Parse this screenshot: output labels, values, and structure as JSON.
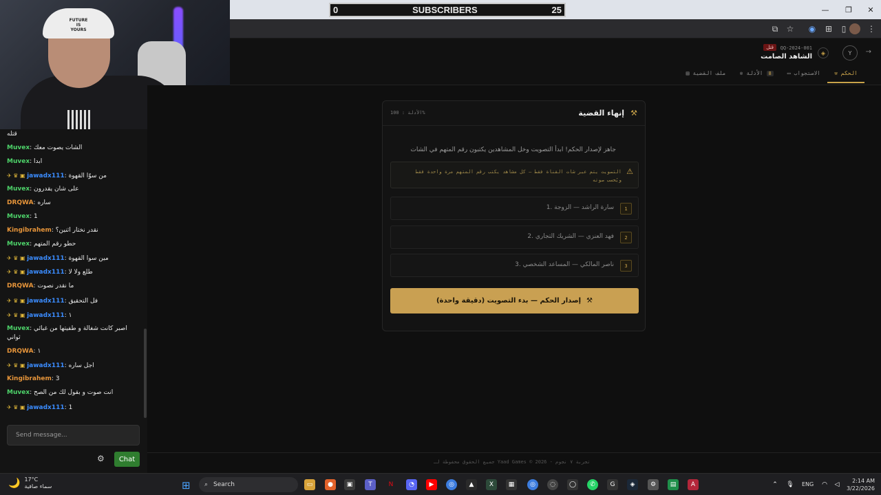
{
  "subscribers": {
    "left": "0",
    "label": "SUBSCRIBERS",
    "right": "25"
  },
  "header": {
    "case_id": "QQ-2024-001",
    "case_badge": "قتل",
    "case_title": "الشاهد الصامت",
    "avatar_initial": "Y",
    "tabs": [
      {
        "label": "الحكم",
        "icon": "gavel-icon",
        "active": true
      },
      {
        "label": "الاستجواب",
        "icon": "chat-icon"
      },
      {
        "label": "الأدلة",
        "icon": "gear-icon",
        "count": "8"
      },
      {
        "label": "ملف القضية",
        "icon": "file-icon"
      }
    ]
  },
  "verdict_card": {
    "title": "إنهاء القضية",
    "evidence": "الأدلة : 100%",
    "ready_text": "جاهز لإصدار الحكم! ابدأ التصويت وخل المشاهدين يكتبون رقم المتهم في الشات",
    "warning": "التصويت يتم عبر شات القناة فقط — كل مشاهد يكتب رقم المتهم مرة واحدة فقط ويُحسب صوته",
    "suspects": [
      {
        "num": "1",
        "name": "1. سارة الراشد — الزوجة"
      },
      {
        "num": "2",
        "name": "2. فهد العنزي — الشريك التجاري"
      },
      {
        "num": "3",
        "name": "3. ناصر المالكي — المساعد الشخصي"
      }
    ],
    "button_label": "إصدار الحكم — بدء التصويت (دقيقة واحدة)"
  },
  "footer": {
    "text": "جميع الحقوق محفوظة لـ Yaad Games © 2026 - تجربة ٧ نجوم"
  },
  "chat": {
    "messages": [
      {
        "user": "",
        "cls": "",
        "text": "قتله"
      },
      {
        "user": "Muvex",
        "cls": "u-muvex",
        "text": "الشات يصوت معك"
      },
      {
        "user": "Muvex",
        "cls": "u-muvex",
        "text": "ابدا"
      },
      {
        "user": "jawadx111",
        "cls": "u-jawad",
        "badges": true,
        "text": "من سوّا القهوة"
      },
      {
        "user": "Muvex",
        "cls": "u-muvex",
        "text": "على شان يقدرون"
      },
      {
        "user": "DRQWA",
        "cls": "u-drqwa",
        "text": "ساره"
      },
      {
        "user": "Muvex",
        "cls": "u-muvex",
        "text": "1"
      },
      {
        "user": "Kingibrahem",
        "cls": "u-king",
        "text": "نقدر نختار اثنين؟"
      },
      {
        "user": "Muvex",
        "cls": "u-muvex",
        "text": "حطو رقم المتهم"
      },
      {
        "user": "jawadx111",
        "cls": "u-jawad",
        "badges": true,
        "text": "مين سوا القهوة"
      },
      {
        "user": "jawadx111",
        "cls": "u-jawad",
        "badges": true,
        "text": "طلع ولا لا"
      },
      {
        "user": "DRQWA",
        "cls": "u-drqwa",
        "text": "ما نقدر نصوت"
      },
      {
        "user": "jawadx111",
        "cls": "u-jawad",
        "badges": true,
        "text": "فل التحقيق"
      },
      {
        "user": "jawadx111",
        "cls": "u-jawad",
        "badges": true,
        "text": "١"
      },
      {
        "user": "Muvex",
        "cls": "u-muvex",
        "text": "اصبر كانت شغالة و طفيتها من غبائي ثواني"
      },
      {
        "user": "DRQWA",
        "cls": "u-drqwa",
        "text": "١"
      },
      {
        "user": "jawadx111",
        "cls": "u-jawad",
        "badges": true,
        "text": "اجل ساره"
      },
      {
        "user": "Kingibrahem",
        "cls": "u-king",
        "text": "3"
      },
      {
        "user": "Muvex",
        "cls": "u-muvex",
        "text": "انت صوت و بقول لك من الصح"
      },
      {
        "user": "jawadx111",
        "cls": "u-jawad",
        "badges": true,
        "text": "1"
      }
    ],
    "send_placeholder": "Send message...",
    "chat_button": "Chat"
  },
  "taskbar": {
    "weather_temp": "17°C",
    "weather_desc": "سماء صافية",
    "search_label": "Search",
    "lang": "ENG",
    "time": "2:14 AM",
    "date": "3/22/2026"
  }
}
